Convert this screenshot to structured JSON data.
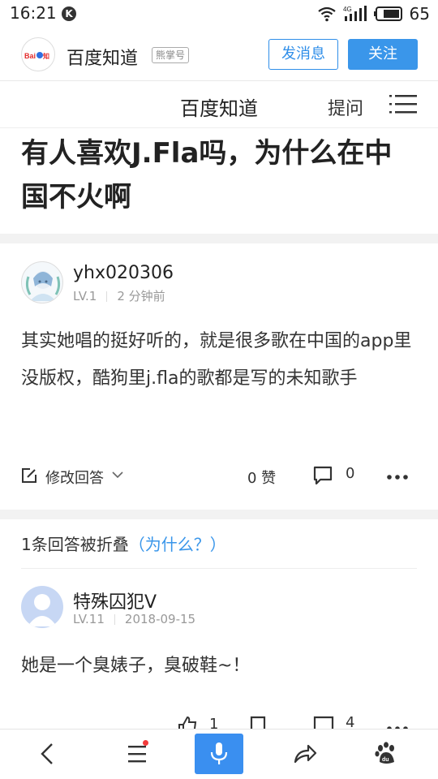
{
  "status_bar": {
    "time": "16:21",
    "network": "4G",
    "battery": "65"
  },
  "account": {
    "name": "百度知道",
    "tag": "熊掌号",
    "message_button": "发消息",
    "follow_button": "关注"
  },
  "nav": {
    "title": "百度知道",
    "ask": "提问"
  },
  "question": {
    "title": "有人喜欢J.Fla吗，为什么在中国不火啊"
  },
  "answer1": {
    "user": "yhx020306",
    "level": "LV.1",
    "time": "2 分钟前",
    "text": "其实她唱的挺好听的，就是很多歌在中国的app里没版权，酷狗里j.fla的歌都是写的未知歌手",
    "edit_label": "修改回答",
    "likes": "0 赞",
    "comments": "0"
  },
  "folded": {
    "text": "1条回答被折叠",
    "why": "（为什么？）"
  },
  "answer2": {
    "user": "特殊囚犯V",
    "level": "LV.11",
    "date": "2018-09-15",
    "text": "她是一个臭婊子，臭破鞋~！",
    "likes": "1",
    "comments": "4"
  },
  "colors": {
    "accent": "#3a96ea",
    "mic": "#3a8ff0",
    "badge_red": "#f23a3a"
  },
  "icons": [
    "k-icon",
    "wifi-icon",
    "signal-icon",
    "battery-icon",
    "baidu-logo",
    "menu-icon",
    "edit-icon",
    "chevron-down-icon",
    "comment-icon",
    "more-icon",
    "like-icon",
    "bookmark-icon",
    "back-icon",
    "list-icon",
    "mic-icon",
    "share-icon",
    "paw-icon"
  ]
}
